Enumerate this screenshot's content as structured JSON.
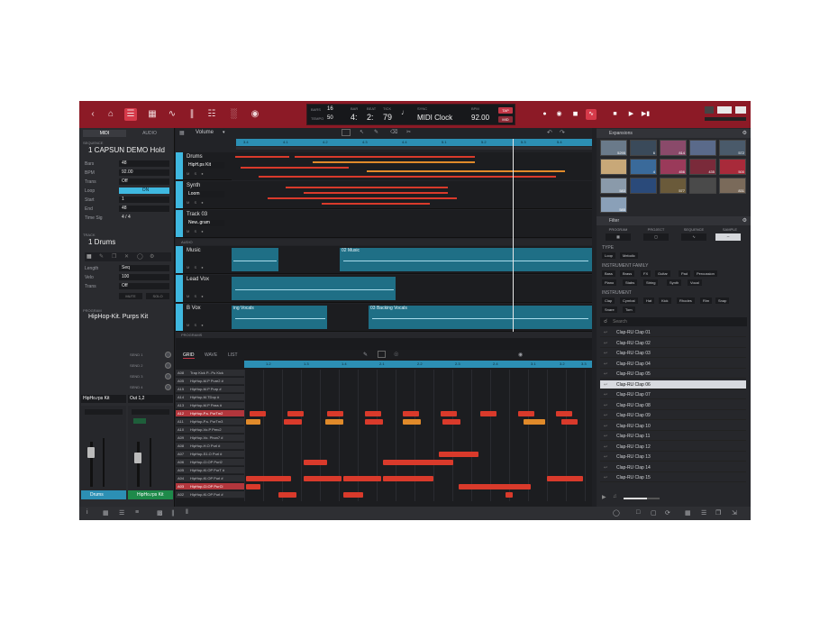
{
  "topbar": {
    "transport": {
      "bars_label": "Bars",
      "bars_value": "16",
      "tempo_label": "Tempo",
      "tempo_value": "50",
      "bar_label": "Bar",
      "beat_label": "Beat",
      "tick_label": "Tick",
      "bar": "4:",
      "beat": "2:",
      "tick": "79",
      "sync_label": "Sync",
      "sync_value": "MIDI Clock",
      "bpm_label": "BPM",
      "bpm_value": "92.00",
      "tap_label": "TAP",
      "mid_label": "MID"
    }
  },
  "left": {
    "tabs": [
      "MIDI",
      "AUDIO"
    ],
    "sequence_head": "Sequence",
    "sequence_name": "1 CAPSUN DEMO Hold",
    "seq_params": [
      {
        "label": "Bars",
        "value": "48"
      },
      {
        "label": "BPM",
        "value": "92.00"
      },
      {
        "label": "Trans",
        "value": "Off"
      },
      {
        "label": "Loop",
        "value": "ON"
      },
      {
        "label": "Start",
        "value": "1"
      },
      {
        "label": "End",
        "value": "48"
      },
      {
        "label": "Time Sig",
        "value": "4     /     4"
      }
    ],
    "track_head": "Track",
    "track_name": "1 Drums",
    "track_params": [
      {
        "label": "Length",
        "value": "Seq"
      },
      {
        "label": "Velo",
        "value": "100"
      },
      {
        "label": "Trans",
        "value": "Off"
      }
    ],
    "mute_label": "MUTE",
    "solo_label": "SOLO",
    "program_head": "Program",
    "program_name": "HipHop-Kit. Purps Kit",
    "sends": [
      "SEND 1",
      "SEND 2",
      "SEND 3",
      "SEND 4"
    ],
    "strip1": {
      "select": "HipHo.rps Kit",
      "name": "Drums"
    },
    "strip2": {
      "select": "Out 1,2",
      "name": "HipHo.rps Kit"
    }
  },
  "tracks": {
    "param": "Volume",
    "ruler": [
      "3.4",
      "4.1",
      "4.2",
      "4.3",
      "4.4",
      "5.1",
      "5.2",
      "5.3",
      "5.4"
    ],
    "items": [
      {
        "name": "Drums",
        "sel": "HipH.ps Kit",
        "color": "#3fb8e0",
        "num": "1"
      },
      {
        "name": "Synth",
        "sel": "Loom",
        "color": "#3fb8e0",
        "num": "2"
      },
      {
        "name": "Track 03",
        "sel": "New..gram",
        "color": "#3fb8e0",
        "num": "3"
      }
    ],
    "audio_head": "AUDIO",
    "audio": [
      {
        "name": "Music",
        "num": "1",
        "clip": "02 Music"
      },
      {
        "name": "Lead Vox",
        "num": "2",
        "clip": ""
      },
      {
        "name": "B Vox",
        "num": "3",
        "clip_a": "ing Vocals",
        "clip_b": "03 Backing Vocals"
      }
    ],
    "programs_head": "PROGRAMS",
    "colors": {
      "accent": "#3fb8e0",
      "midi_red": "#d93a2b",
      "midi_orange": "#e08a2a"
    }
  },
  "pianoroll": {
    "tabs": [
      "GRID",
      "WAVE",
      "LIST"
    ],
    "ruler": [
      "1.2",
      "1.3",
      "1.4",
      "2.1",
      "2.2",
      "2.3",
      "2.4",
      "3.1",
      "3.2",
      "3.3"
    ],
    "keys": [
      {
        "n": "A08",
        "label": "Trap Kick P...Pu Kick"
      },
      {
        "n": "A05",
        "label": "HipHop-M.P Pure2 #"
      },
      {
        "n": "A15",
        "label": "HipHop-M.P Purp #"
      },
      {
        "n": "A14",
        "label": "HipHop-M.TDop #"
      },
      {
        "n": "A13",
        "label": "HipHop-M.P Pass #"
      },
      {
        "n": "A12",
        "label": "HipHop-P.s. PurTm2"
      },
      {
        "n": "A11",
        "label": "HipHop-P.s. PurTm3"
      },
      {
        "n": "A10",
        "label": "HipHop-Vo.P Perc2"
      },
      {
        "n": "A09",
        "label": "HipHop-Vo. Phon7 #"
      },
      {
        "n": "A08",
        "label": "HipHop-H.O Purl #"
      },
      {
        "n": "A07",
        "label": "HipHop-S1.O Purl #"
      },
      {
        "n": "A06",
        "label": "HipHop-Cl.OP Purl2"
      },
      {
        "n": "A05",
        "label": "HipHop-Kl.OP PurT #"
      },
      {
        "n": "A04",
        "label": "HipHop-Kl.OP Purl #"
      },
      {
        "n": "A03",
        "label": "HipHop-Cl.OP PurCl"
      },
      {
        "n": "A02",
        "label": "HipHop-Kl.OP Purl #"
      }
    ]
  },
  "right": {
    "expansions_head": "Expansions",
    "thumb_counts": [
      "5295",
      "6",
      "814",
      "",
      "572",
      "",
      "4",
      "456",
      "435",
      "500",
      "583",
      "",
      "577",
      "",
      "831",
      "585"
    ],
    "filter_head": "Filter",
    "filter_tabs": [
      "Program",
      "Project",
      "Sequence",
      "Sample"
    ],
    "type_head": "TYPE",
    "type_chips": [
      "Loop",
      "Melodic"
    ],
    "family_head": "INSTRUMENT FAMILY",
    "family_chips": [
      "Bass",
      "Brass",
      "FX",
      "Guitar",
      "Pad",
      "Percussion",
      "Piano",
      "Stabs",
      "String",
      "Synth",
      "Vocal"
    ],
    "instrument_head": "INSTRUMENT",
    "instrument_chips": [
      "Clap",
      "Cymbal",
      "Hat",
      "Kick",
      "Rhodes",
      "Rim",
      "Snap",
      "Snare",
      "Tom"
    ],
    "search_placeholder": "Search",
    "samples": [
      "Clap-RU Clap 01",
      "Clap-RU Clap 02",
      "Clap-RU Clap 03",
      "Clap-RU Clap 04",
      "Clap-RU Clap 05",
      "Clap-RU Clap 06",
      "Clap-RU Clap 07",
      "Clap-RU Clap 08",
      "Clap-RU Clap 09",
      "Clap-RU Clap 10",
      "Clap-RU Clap 11",
      "Clap-RU Clap 12",
      "Clap-RU Clap 13",
      "Clap-RU Clap 14",
      "Clap-RU Clap 15"
    ],
    "selected_index": 5
  }
}
